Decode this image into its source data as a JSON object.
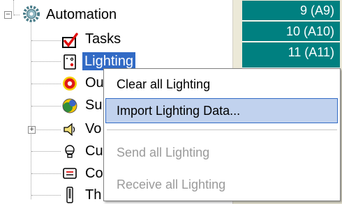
{
  "tree": {
    "root": {
      "label": "Automation",
      "expander": "−"
    },
    "items": [
      {
        "label": "Tasks",
        "icon": "tasks-check-icon"
      },
      {
        "label": "Lighting",
        "icon": "lighting-switch-icon",
        "selected": true
      },
      {
        "label": "Ou",
        "icon": "outputs-icon"
      },
      {
        "label": "Su",
        "icon": "sun-icon"
      },
      {
        "label": "Vo",
        "icon": "voice-speaker-icon",
        "expander": "+"
      },
      {
        "label": "Cu",
        "icon": "bulb-icon"
      },
      {
        "label": "Co",
        "icon": "console-icon"
      },
      {
        "label": "Th",
        "icon": "thermostat-icon"
      }
    ]
  },
  "grid": {
    "cells": [
      "9 (A9)",
      "10 (A10)",
      "11 (A11)"
    ]
  },
  "context_menu": {
    "items": [
      {
        "label": "Clear all Lighting",
        "enabled": true
      },
      {
        "label": "Import Lighting Data...",
        "enabled": true,
        "highlighted": true
      },
      {
        "label": "Send all Lighting",
        "enabled": false
      },
      {
        "label": "Receive all Lighting",
        "enabled": false
      }
    ]
  },
  "colors": {
    "selection": "#316ac5",
    "menu_highlight": "#c1d2ee",
    "grid_cell": "#008080",
    "disabled_text": "#9a9a9a"
  }
}
